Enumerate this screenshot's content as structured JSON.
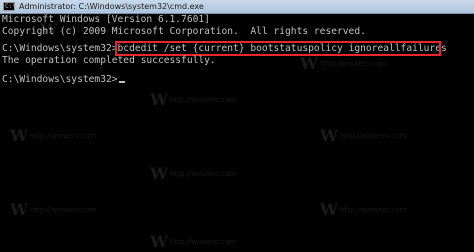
{
  "window": {
    "title": "Administrator: C:\\Windows\\system32\\cmd.exe",
    "icon": "cmd-icon"
  },
  "console": {
    "line1": "Microsoft Windows [Version 6.1.7601]",
    "line2": "Copyright (c) 2009 Microsoft Corporation.  All rights reserved.",
    "prompt1": "C:\\Windows\\system32>",
    "command": "bcdedit /set {current} bootstatuspolicy ignoreallfailures",
    "result": "The operation completed successfully.",
    "prompt2": "C:\\Windows\\system32>"
  },
  "colors": {
    "background": "#000000",
    "text": "#c0c0c0",
    "highlight_border": "#e8262b"
  },
  "watermark": {
    "text": "http://winaero.com"
  }
}
